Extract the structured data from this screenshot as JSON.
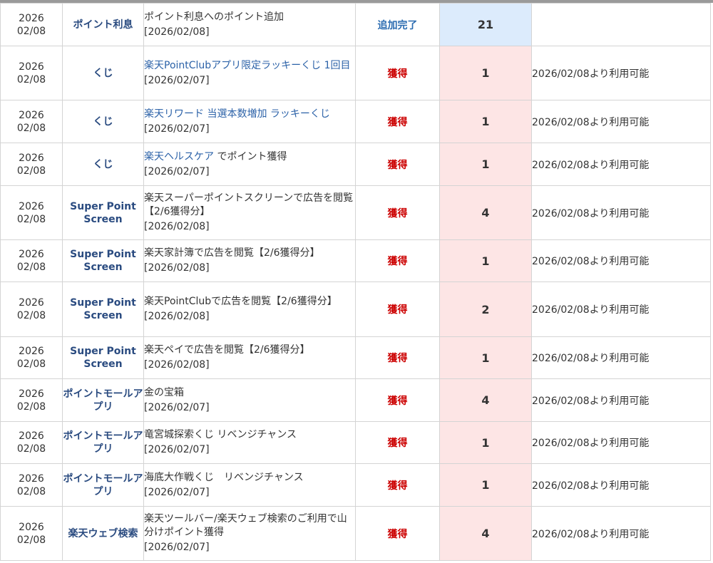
{
  "rows": [
    {
      "year": "2026",
      "md": "02/08",
      "service": "ポイント利息",
      "detail_link": "",
      "detail_text": "ポイント利息へのポイント追加",
      "detail_date": "[2026/02/08]",
      "action": "追加完了",
      "action_type": "add",
      "points": "21",
      "note": "",
      "height": 60
    },
    {
      "year": "2026",
      "md": "02/08",
      "service": "くじ",
      "detail_link": "楽天PointClubアプリ限定ラッキーくじ 1回目",
      "detail_text": "",
      "detail_date": "[2026/02/07]",
      "action": "獲得",
      "action_type": "earn",
      "points": "1",
      "note": "2026/02/08より利用可能",
      "height": 76
    },
    {
      "year": "2026",
      "md": "02/08",
      "service": "くじ",
      "detail_link": "楽天リワード 当選本数増加 ラッキーくじ",
      "detail_text": "",
      "detail_date": "[2026/02/07]",
      "action": "獲得",
      "action_type": "earn",
      "points": "1",
      "note": "2026/02/08より利用可能",
      "height": 60
    },
    {
      "year": "2026",
      "md": "02/08",
      "service": "くじ",
      "detail_link": "楽天ヘルスケア",
      "detail_text": " でポイント獲得",
      "detail_date": "[2026/02/07]",
      "action": "獲得",
      "action_type": "earn",
      "points": "1",
      "note": "2026/02/08より利用可能",
      "height": 60
    },
    {
      "year": "2026",
      "md": "02/08",
      "service": "Super Point Screen",
      "detail_link": "",
      "detail_text": "楽天スーパーポイントスクリーンで広告を閲覧 【2/6獲得分】",
      "detail_date": "[2026/02/08]",
      "action": "獲得",
      "action_type": "earn",
      "points": "4",
      "note": "2026/02/08より利用可能",
      "height": 76
    },
    {
      "year": "2026",
      "md": "02/08",
      "service": "Super Point Screen",
      "detail_link": "",
      "detail_text": "楽天家計簿で広告を閲覧【2/6獲得分】",
      "detail_date": "[2026/02/08]",
      "action": "獲得",
      "action_type": "earn",
      "points": "1",
      "note": "2026/02/08より利用可能",
      "height": 59
    },
    {
      "year": "2026",
      "md": "02/08",
      "service": "Super Point Screen",
      "detail_link": "",
      "detail_text": "楽天PointClubで広告を閲覧【2/6獲得分】",
      "detail_date": "[2026/02/08]",
      "action": "獲得",
      "action_type": "earn",
      "points": "2",
      "note": "2026/02/08より利用可能",
      "height": 77
    },
    {
      "year": "2026",
      "md": "02/08",
      "service": "Super Point Screen",
      "detail_link": "",
      "detail_text": "楽天ペイで広告を閲覧【2/6獲得分】",
      "detail_date": "[2026/02/08]",
      "action": "獲得",
      "action_type": "earn",
      "points": "1",
      "note": "2026/02/08より利用可能",
      "height": 59
    },
    {
      "year": "2026",
      "md": "02/08",
      "service": "ポイントモールアプリ",
      "detail_link": "",
      "detail_text": "金の宝箱",
      "detail_date": "[2026/02/07]",
      "action": "獲得",
      "action_type": "earn",
      "points": "4",
      "note": "2026/02/08より利用可能",
      "height": 60
    },
    {
      "year": "2026",
      "md": "02/08",
      "service": "ポイントモールアプリ",
      "detail_link": "",
      "detail_text": "竜宮城探索くじ リベンジチャンス",
      "detail_date": "[2026/02/07]",
      "action": "獲得",
      "action_type": "earn",
      "points": "1",
      "note": "2026/02/08より利用可能",
      "height": 59
    },
    {
      "year": "2026",
      "md": "02/08",
      "service": "ポイントモールアプリ",
      "detail_link": "",
      "detail_text": "海底大作戦くじ　リベンジチャンス",
      "detail_date": "[2026/02/07]",
      "action": "獲得",
      "action_type": "earn",
      "points": "1",
      "note": "2026/02/08より利用可能",
      "height": 60
    },
    {
      "year": "2026",
      "md": "02/08",
      "service": "楽天ウェブ検索",
      "detail_link": "",
      "detail_text": "楽天ツールバー/楽天ウェブ検索のご利用で山分けポイント獲得",
      "detail_date": "[2026/02/07]",
      "action": "獲得",
      "action_type": "earn",
      "points": "4",
      "note": "2026/02/08より利用可能",
      "height": 76
    }
  ]
}
